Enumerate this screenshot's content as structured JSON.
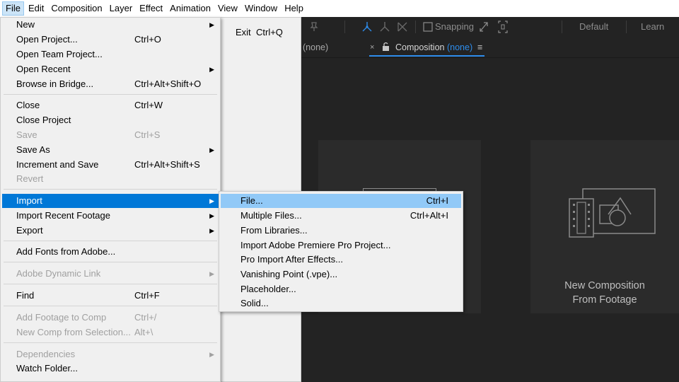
{
  "menubar": {
    "items": [
      "File",
      "Edit",
      "Composition",
      "Layer",
      "Effect",
      "Animation",
      "View",
      "Window",
      "Help"
    ],
    "active": "File"
  },
  "toolbar": {
    "snapping_label": "Snapping",
    "workspace_default": "Default",
    "workspace_learn": "Learn"
  },
  "panels": {
    "left_tab": "(none)",
    "comp_tab_label": "Composition",
    "comp_tab_value": "(none)"
  },
  "cards": {
    "new_comp_from_footage_line1": "New Composition",
    "new_comp_from_footage_line2": "From Footage"
  },
  "file_menu": {
    "items": [
      {
        "label": "New",
        "shortcut": "",
        "submenu": true,
        "disabled": false
      },
      {
        "label": "Open Project...",
        "shortcut": "Ctrl+O",
        "submenu": false,
        "disabled": false
      },
      {
        "label": "Open Team Project...",
        "shortcut": "",
        "submenu": false,
        "disabled": false
      },
      {
        "label": "Open Recent",
        "shortcut": "",
        "submenu": true,
        "disabled": false
      },
      {
        "label": "Browse in Bridge...",
        "shortcut": "Ctrl+Alt+Shift+O",
        "submenu": false,
        "disabled": false
      },
      {
        "label": "Close",
        "shortcut": "Ctrl+W",
        "submenu": false,
        "disabled": false
      },
      {
        "label": "Close Project",
        "shortcut": "",
        "submenu": false,
        "disabled": false
      },
      {
        "label": "Save",
        "shortcut": "Ctrl+S",
        "submenu": false,
        "disabled": true
      },
      {
        "label": "Save As",
        "shortcut": "",
        "submenu": true,
        "disabled": false
      },
      {
        "label": "Increment and Save",
        "shortcut": "Ctrl+Alt+Shift+S",
        "submenu": false,
        "disabled": false
      },
      {
        "label": "Revert",
        "shortcut": "",
        "submenu": false,
        "disabled": true
      },
      {
        "label": "Import",
        "shortcut": "",
        "submenu": true,
        "disabled": false,
        "highlighted": true
      },
      {
        "label": "Import Recent Footage",
        "shortcut": "",
        "submenu": true,
        "disabled": false
      },
      {
        "label": "Export",
        "shortcut": "",
        "submenu": true,
        "disabled": false
      },
      {
        "label": "Add Fonts from Adobe...",
        "shortcut": "",
        "submenu": false,
        "disabled": false
      },
      {
        "label": "Adobe Dynamic Link",
        "shortcut": "",
        "submenu": true,
        "disabled": true
      },
      {
        "label": "Find",
        "shortcut": "Ctrl+F",
        "submenu": false,
        "disabled": false
      },
      {
        "label": "Add Footage to Comp",
        "shortcut": "Ctrl+/",
        "submenu": false,
        "disabled": true
      },
      {
        "label": "New Comp from Selection...",
        "shortcut": "Alt+\\",
        "submenu": false,
        "disabled": true
      },
      {
        "label": "Dependencies",
        "shortcut": "",
        "submenu": true,
        "disabled": true
      },
      {
        "label": "Watch Folder...",
        "shortcut": "",
        "submenu": false,
        "disabled": false
      }
    ]
  },
  "exit_item": {
    "label": "Exit",
    "shortcut": "Ctrl+Q"
  },
  "import_submenu": {
    "items": [
      {
        "label": "File...",
        "shortcut": "Ctrl+I",
        "highlighted": true
      },
      {
        "label": "Multiple Files...",
        "shortcut": "Ctrl+Alt+I"
      },
      {
        "label": "From Libraries...",
        "shortcut": ""
      },
      {
        "label": "Import Adobe Premiere Pro Project...",
        "shortcut": ""
      },
      {
        "label": "Pro Import After Effects...",
        "shortcut": ""
      },
      {
        "label": "Vanishing Point (.vpe)...",
        "shortcut": ""
      },
      {
        "label": "Placeholder...",
        "shortcut": ""
      },
      {
        "label": "Solid...",
        "shortcut": ""
      }
    ]
  },
  "colors": {
    "app_bg": "#232323",
    "accent_blue": "#2d8ceb",
    "menu_bg": "#f0f0f0",
    "menu_highlight": "#0078d7",
    "submenu_highlight": "#91c9f7"
  }
}
